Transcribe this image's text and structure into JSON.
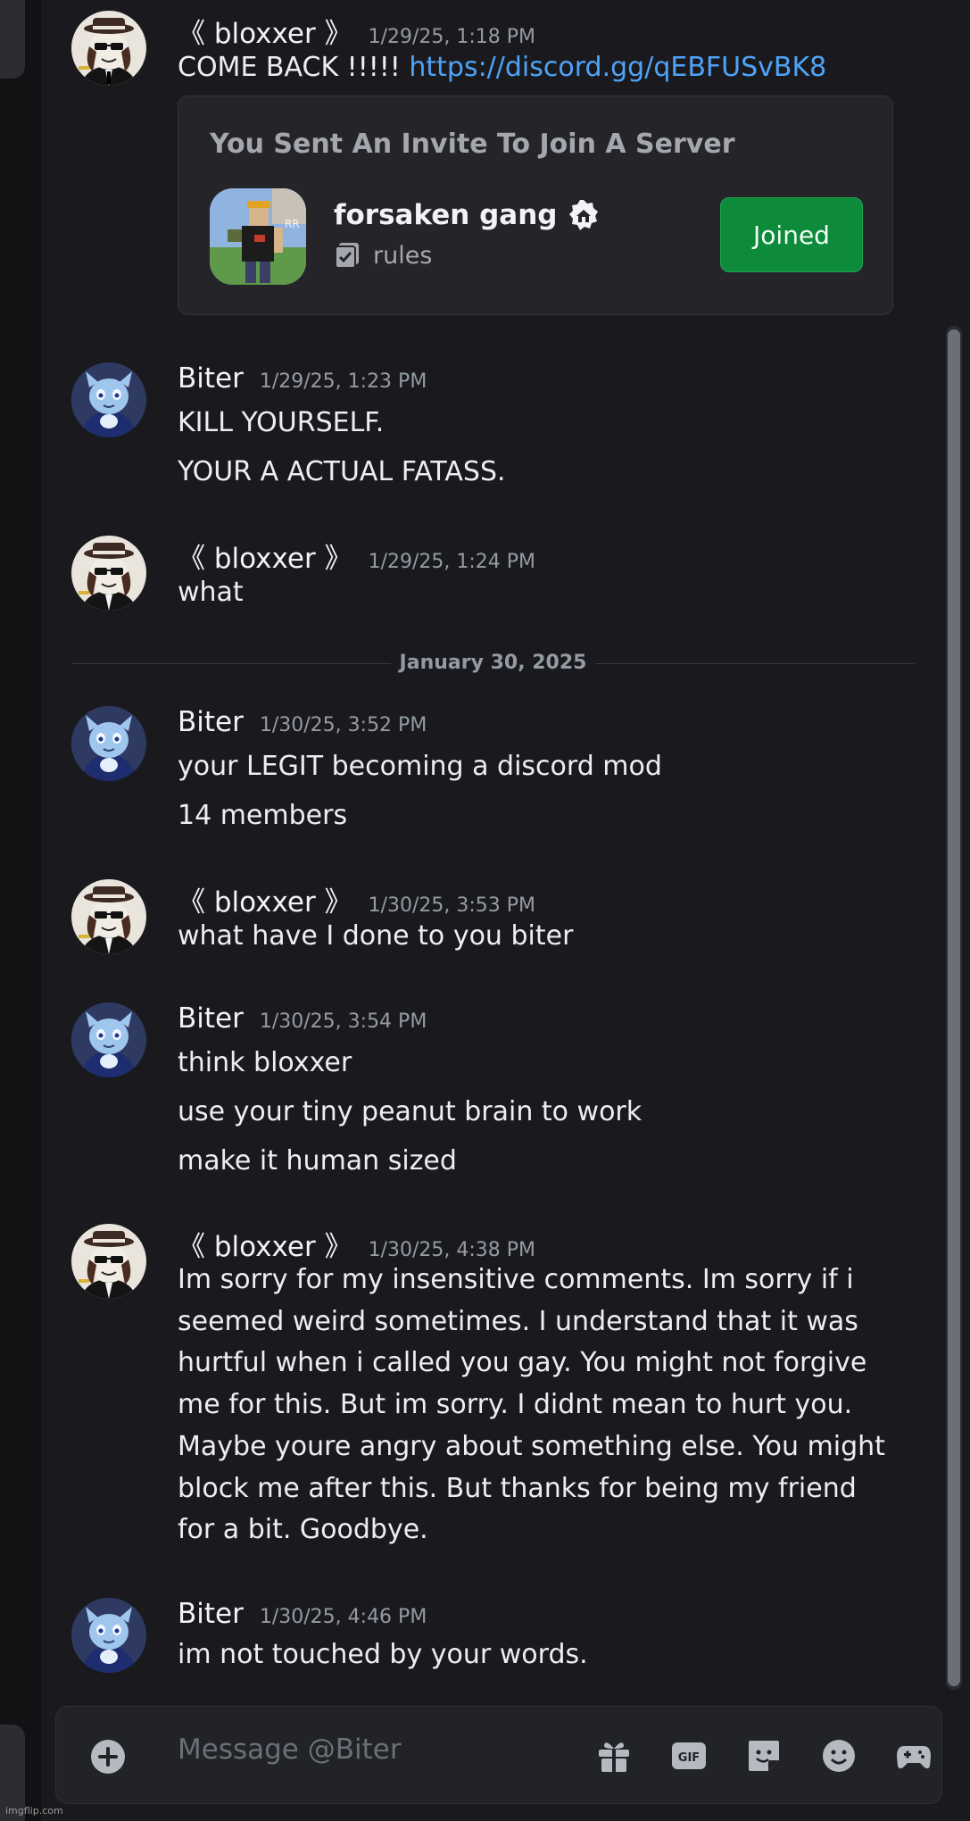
{
  "conversation": {
    "recipient": "Biter",
    "messages": [
      {
        "author": "《 bloxxer 》",
        "timestamp": "1/29/25, 1:18 PM",
        "text": "COME BACK !!!!!",
        "link": "https://discord.gg/qEBFUSvBK8",
        "invite": {
          "title": "You Sent An Invite To Join A Server",
          "server_name": "forsaken gang",
          "channel": "rules",
          "button_label": "Joined",
          "server_icon": "roblox-avatar-image",
          "badge_icon": "guild-home-badge-icon",
          "channel_icon": "rules-channel-icon"
        }
      },
      {
        "author": "Biter",
        "timestamp": "1/29/25, 1:23 PM",
        "lines": [
          "KILL YOURSELF.",
          "YOUR A ACTUAL FATASS."
        ]
      },
      {
        "author": "《 bloxxer 》",
        "timestamp": "1/29/25, 1:24 PM",
        "lines": [
          "what"
        ]
      },
      {
        "author": "Biter",
        "timestamp": "1/30/25, 3:52 PM",
        "lines": [
          "your LEGIT becoming a discord mod",
          "14 members"
        ]
      },
      {
        "author": "《 bloxxer 》",
        "timestamp": "1/30/25, 3:53 PM",
        "lines": [
          "what have I done to you biter"
        ]
      },
      {
        "author": "Biter",
        "timestamp": "1/30/25, 3:54 PM",
        "lines": [
          "think bloxxer",
          "use your tiny peanut brain to work",
          "make it human sized"
        ]
      },
      {
        "author": "《 bloxxer 》",
        "timestamp": "1/30/25, 4:38 PM",
        "paragraph": "Im sorry for my insensitive comments. Im sorry if i seemed weird sometimes. I understand that it was hurtful when i called you gay. You might not forgive me for this.  But im sorry. I didnt mean to hurt you. Maybe youre angry about something else. You might block me after this. But thanks for being my friend for a bit. Goodbye."
      },
      {
        "author": "Biter",
        "timestamp": "1/30/25, 4:46 PM",
        "lines": [
          "im not touched by your words."
        ]
      }
    ]
  },
  "date_divider": "January 30, 2025",
  "composer": {
    "placeholder": "Message @Biter",
    "icons": [
      "add-attachment-icon",
      "gift-icon",
      "gif-icon",
      "sticker-icon",
      "emoji-icon",
      "activities-icon"
    ]
  },
  "watermark": "imgflip.com",
  "colors": {
    "background": "#1a1a1e",
    "link": "#4fa3f7",
    "joined_button": "#0d8a3a",
    "timestamp": "#949ba4"
  }
}
